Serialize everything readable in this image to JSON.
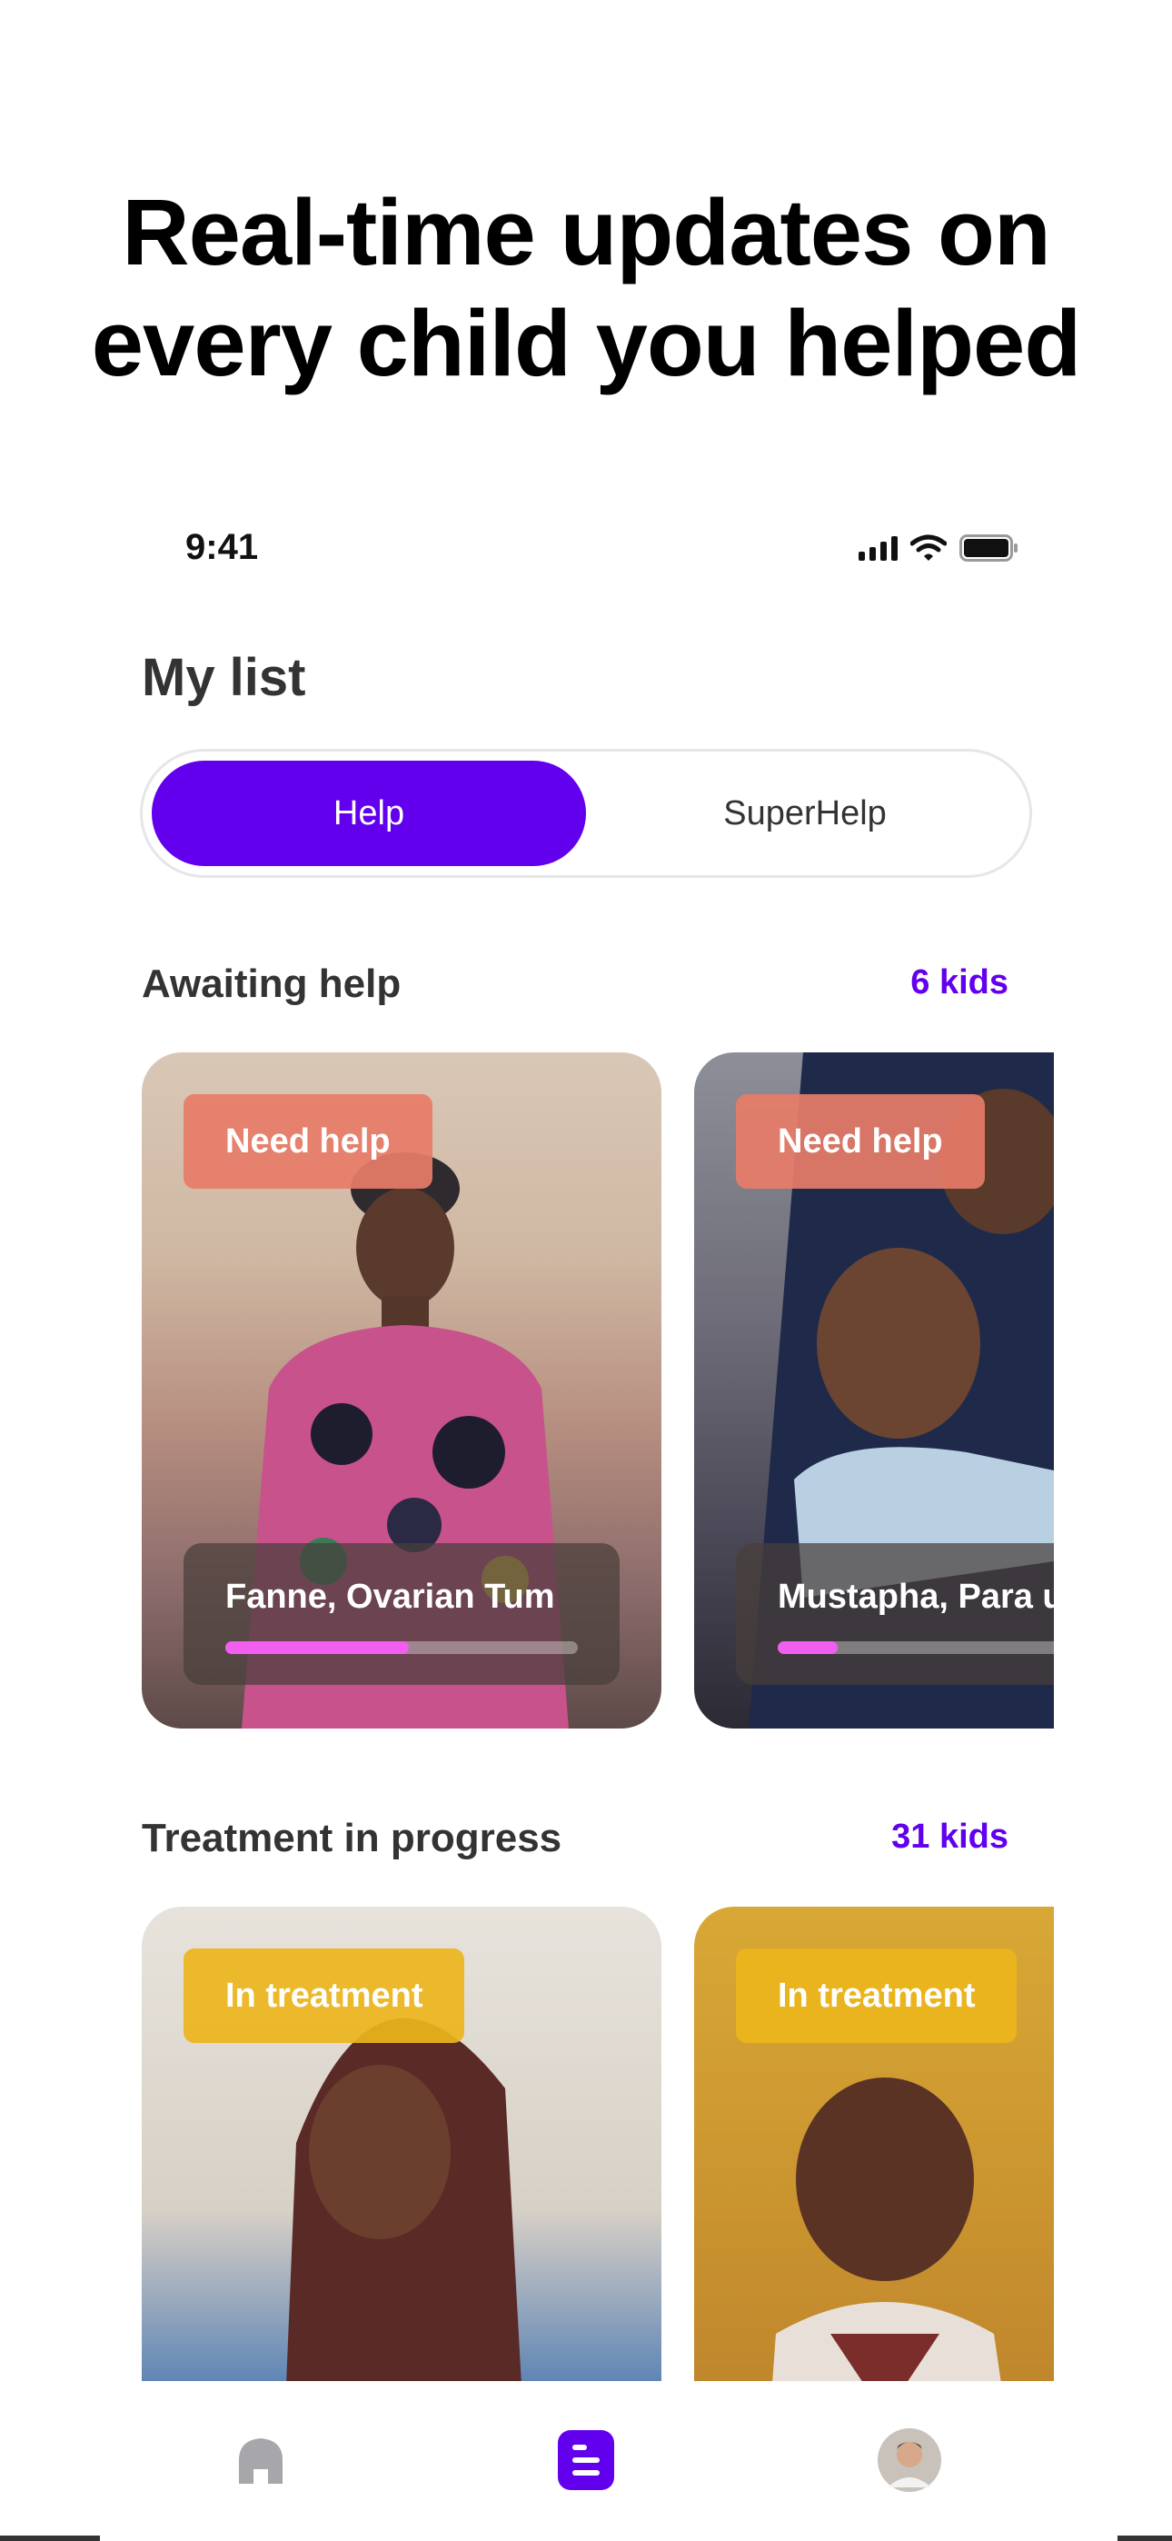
{
  "headline": {
    "line1": "Real-time updates on",
    "line2": "every child you helped"
  },
  "status_bar": {
    "time": "9:41",
    "icons": [
      "cellular-signal-icon",
      "wifi-icon",
      "battery-icon"
    ]
  },
  "page_title": "My list",
  "segmented_control": {
    "options": [
      {
        "label": "Help",
        "selected": true
      },
      {
        "label": "SuperHelp",
        "selected": false
      }
    ]
  },
  "sections": [
    {
      "title": "Awaiting help",
      "count": "6 kids",
      "cards": [
        {
          "badge": "Need help",
          "name": "Fanne, Ovarian Tum",
          "progress": 0.52
        },
        {
          "badge": "Need help",
          "name": "Mustapha, Para un",
          "progress": 0.17
        }
      ]
    },
    {
      "title": "Treatment in progress",
      "count": "31 kids",
      "cards": [
        {
          "badge": "In treatment"
        },
        {
          "badge": "In treatment"
        }
      ]
    }
  ],
  "tab_bar": {
    "items": [
      {
        "icon": "home-icon",
        "active": false
      },
      {
        "icon": "list-icon",
        "active": true
      },
      {
        "icon": "profile-avatar-icon",
        "active": false
      }
    ]
  },
  "colors": {
    "accent": "#6200ee",
    "need_help_badge": "#e77c68",
    "in_treatment_badge": "#ecb51c",
    "progress_fill": "#f25ef0"
  }
}
